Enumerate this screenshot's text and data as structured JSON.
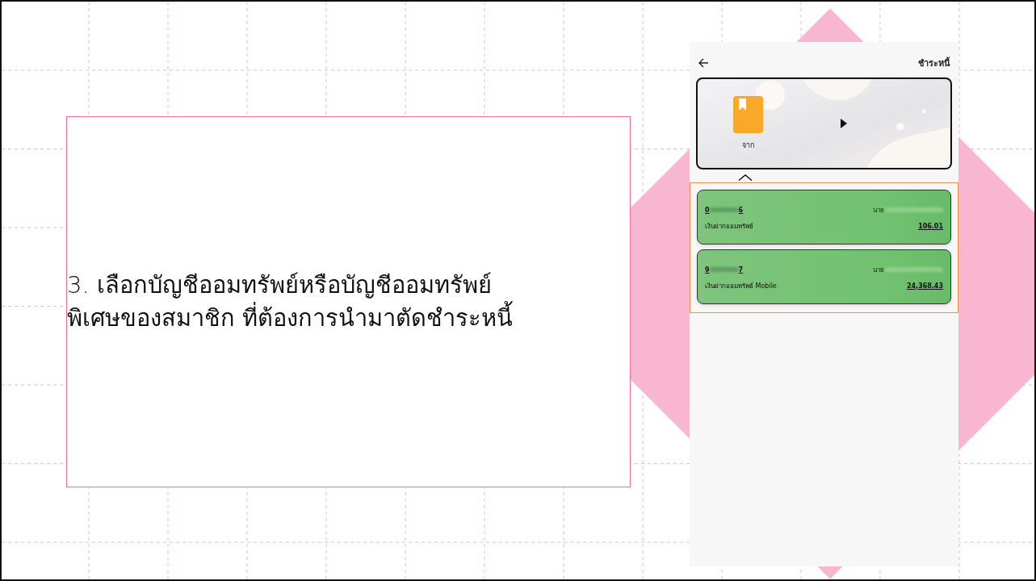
{
  "instruction": {
    "text": "3. เลือกบัญชีออมทรัพย์หรือบัญชีออมทรัพย์\nพิเศษของสมาชิก ที่ต้องการนำมาตัดชำระหนี้"
  },
  "phone": {
    "title": "ชำระหนี้",
    "source": {
      "label": "จาก"
    },
    "accounts": [
      {
        "number_start": "0",
        "number_end": "6",
        "owner_prefix": "นาย",
        "type": "เงินฝากออมทรัพย์",
        "balance": "106.01"
      },
      {
        "number_start": "9",
        "number_end": "7",
        "owner_prefix": "นาย",
        "type": "เงินฝากออมทรัพย์ Mobile",
        "balance": "24,368.43"
      }
    ]
  }
}
